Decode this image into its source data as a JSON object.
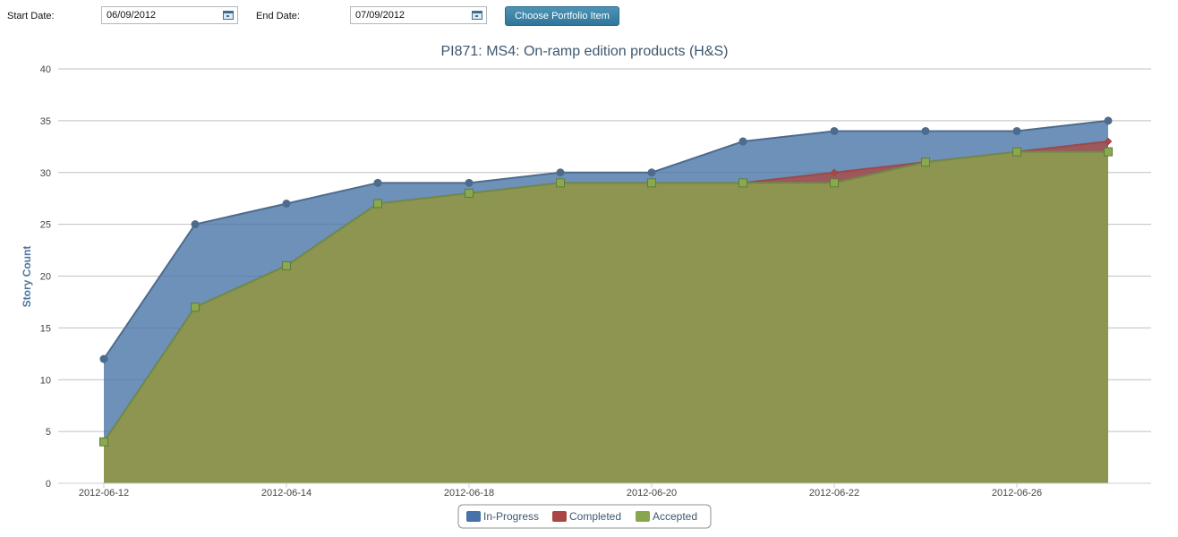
{
  "toolbar": {
    "start_label": "Start Date:",
    "start_value": "06/09/2012",
    "end_label": "End Date:",
    "end_value": "07/09/2012",
    "button_label": "Choose Portfolio Item"
  },
  "chart_data": {
    "type": "area",
    "title": "PI871: MS4: On-ramp edition products (H&S)",
    "xlabel": "",
    "ylabel": "Story Count",
    "ylim": [
      0,
      40
    ],
    "yticks": [
      0,
      5,
      10,
      15,
      20,
      25,
      30,
      35,
      40
    ],
    "x": [
      "2012-06-12",
      "2012-06-13",
      "2012-06-14",
      "2012-06-16",
      "2012-06-18",
      "2012-06-19",
      "2012-06-20",
      "2012-06-21",
      "2012-06-22",
      "2012-06-24",
      "2012-06-26",
      "2012-06-27"
    ],
    "xtick_labels": [
      "2012-06-12",
      "2012-06-14",
      "2012-06-18",
      "2012-06-20",
      "2012-06-22",
      "2012-06-26"
    ],
    "xtick_index": [
      0,
      2,
      4,
      6,
      8,
      10
    ],
    "series": [
      {
        "name": "In-Progress",
        "color": "#4572a7",
        "marker": "circle",
        "values": [
          12,
          25,
          27,
          29,
          29,
          30,
          30,
          33,
          34,
          34,
          34,
          35
        ]
      },
      {
        "name": "Completed",
        "color": "#aa4643",
        "marker": "diamond",
        "values": [
          4,
          17,
          21,
          27,
          28,
          29,
          29,
          29,
          30,
          31,
          32,
          33
        ]
      },
      {
        "name": "Accepted",
        "color": "#89a54e",
        "marker": "square",
        "values": [
          4,
          17,
          21,
          27,
          28,
          29,
          29,
          29,
          29,
          31,
          32,
          32
        ]
      }
    ],
    "grid": true,
    "legend": "bottom-center"
  }
}
